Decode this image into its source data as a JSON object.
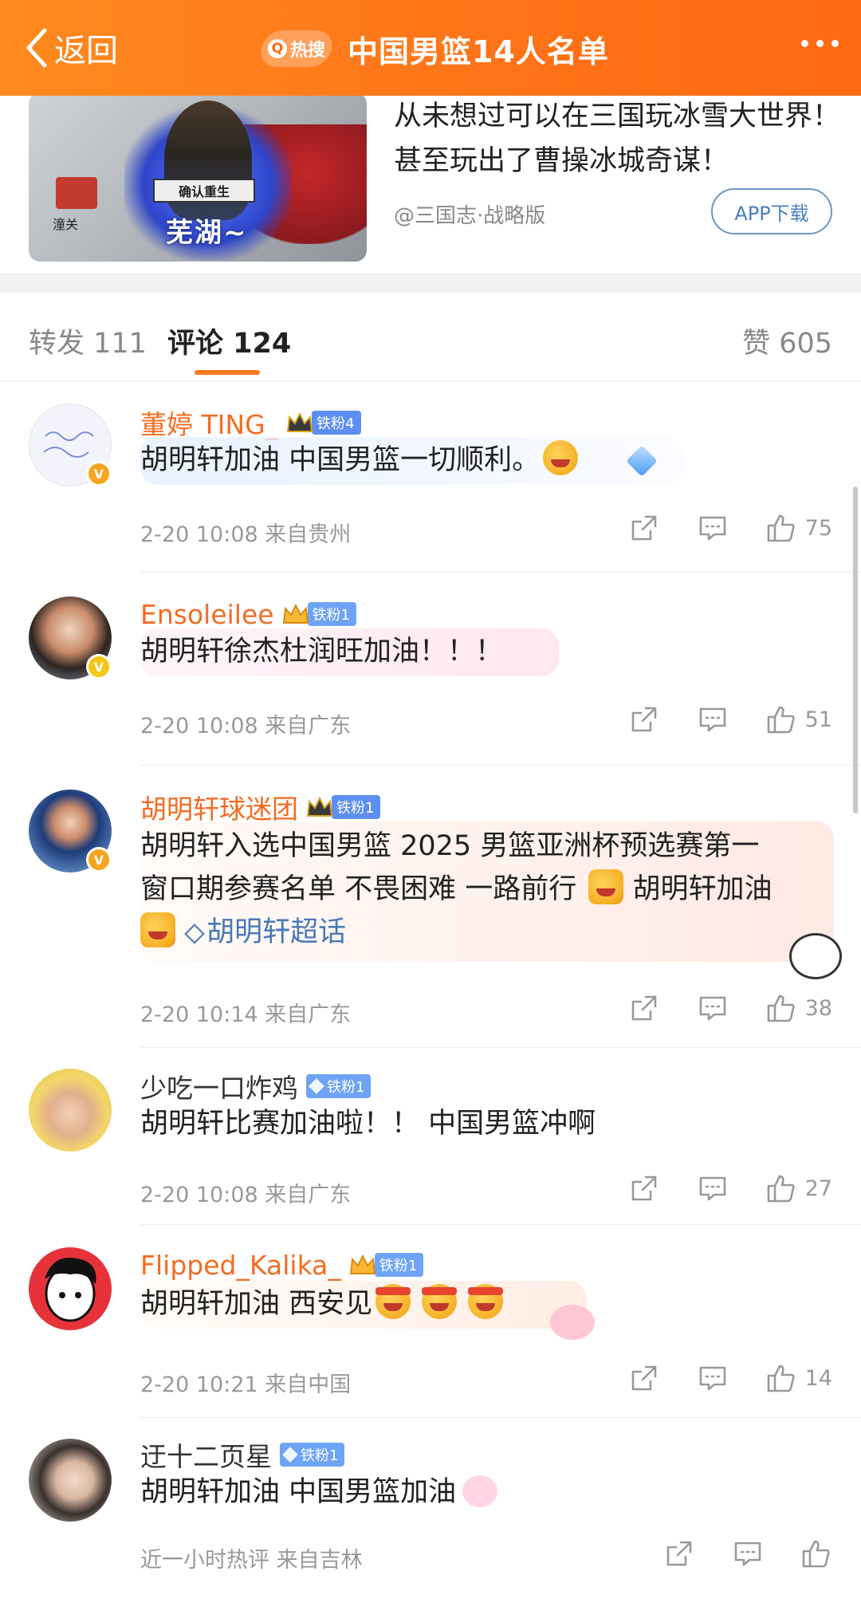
{
  "header": {
    "back_label": "返回",
    "hot_badge": "热搜",
    "title": "中国男篮14人名单"
  },
  "ad": {
    "text": "从未想过可以在三国玩冰雪大世界！甚至玩出了曹操冰城奇谋！",
    "source": "@三国志·战略版",
    "button": "APP下载",
    "image_banner": "确认重生",
    "image_big": "芜湖~",
    "image_gate": "潼关"
  },
  "tabs": {
    "repost": "转发 111",
    "comment": "评论 124",
    "like": "赞 605"
  },
  "colors": {
    "header_orange": "#ff7418",
    "username_orange": "#f36c21",
    "fan_badge_blue": "#5d8ff2",
    "topic_blue": "#4a78b8",
    "tab_underline": "#ff7a1c"
  },
  "comments": [
    {
      "username": "董婷 TING_",
      "fan_badge": "铁粉4",
      "text": "胡明轩加油 中国男篮一切顺利。",
      "time": "2-20 10:08",
      "location": "来自贵州",
      "likes": "75"
    },
    {
      "username": "Ensoleilee",
      "fan_badge": "铁粉1",
      "text": "胡明轩徐杰杜润旺加油！！！",
      "time": "2-20 10:08",
      "location": "来自广东",
      "likes": "51"
    },
    {
      "username": "胡明轩球迷团",
      "fan_badge": "铁粉1",
      "text_line1": "胡明轩入选中国男篮 2025 男篮亚洲杯预选赛第一",
      "text_line2": "窗口期参赛名单 不畏困难 一路前行",
      "text_line2b": "胡明轩加油",
      "topic": "胡明轩超话",
      "time": "2-20 10:14",
      "location": "来自广东",
      "likes": "38"
    },
    {
      "username": "少吃一口炸鸡",
      "fan_badge": "铁粉1",
      "text": "胡明轩比赛加油啦！！ 中国男篮冲啊",
      "time": "2-20 10:08",
      "location": "来自广东",
      "likes": "27"
    },
    {
      "username": "Flipped_Kalika_",
      "fan_badge": "铁粉1",
      "text": "胡明轩加油 西安见",
      "time": "2-20 10:21",
      "location": "来自中国",
      "likes": "14"
    },
    {
      "username": "迂十二页星",
      "fan_badge": "铁粉1",
      "text": "胡明轩加油 中国男篮加油",
      "time": "近一小时热评",
      "location": "来自吉林"
    }
  ]
}
